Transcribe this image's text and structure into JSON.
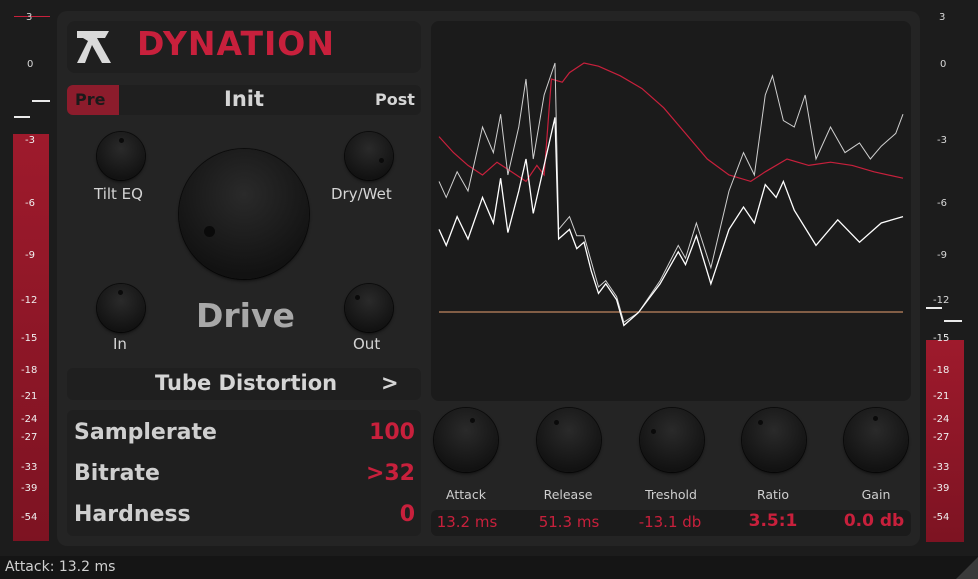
{
  "app": {
    "brand": "DYNATION",
    "accent": "#c8203c"
  },
  "meter_left": {
    "ticks": [
      "3",
      "0",
      "-3",
      "-6",
      "-9",
      "-12",
      "-15",
      "-18",
      "-21",
      "-24",
      "-27",
      "-33",
      "-39",
      "-54"
    ]
  },
  "meter_right": {
    "ticks": [
      "3",
      "0",
      "-3",
      "-6",
      "-9",
      "-12",
      "-15",
      "-18",
      "-21",
      "-24",
      "-27",
      "-33",
      "-39",
      "-54"
    ]
  },
  "routing": {
    "pre": "Pre",
    "preset": "Init",
    "post": "Post"
  },
  "knobs": {
    "tilt_eq": "Tilt EQ",
    "dry_wet": "Dry/Wet",
    "drive": "Drive",
    "in": "In",
    "out": "Out"
  },
  "mode": {
    "name": "Tube Distortion",
    "next": ">"
  },
  "params": [
    {
      "name": "Samplerate",
      "value": "100"
    },
    {
      "name": "Bitrate",
      "value": ">32"
    },
    {
      "name": "Hardness",
      "value": "0"
    }
  ],
  "comp": {
    "labels": [
      "Attack",
      "Release",
      "Treshold",
      "Ratio",
      "Gain"
    ],
    "values": [
      "13.2 ms",
      "51.3 ms",
      "-13.1 db",
      "3.5:1",
      "0.0 db"
    ]
  },
  "status": {
    "text": "Attack: 13.2 ms"
  },
  "scope": {
    "colors": {
      "red": "#c8203c",
      "white": "#ffffff",
      "grey": "#cfcfcf",
      "threshold": "#e8a070"
    },
    "series": {
      "white": [
        [
          0,
          0.62
        ],
        [
          0.02,
          0.67
        ],
        [
          0.05,
          0.58
        ],
        [
          0.08,
          0.65
        ],
        [
          0.12,
          0.52
        ],
        [
          0.15,
          0.6
        ],
        [
          0.17,
          0.46
        ],
        [
          0.19,
          0.63
        ],
        [
          0.22,
          0.5
        ],
        [
          0.24,
          0.4
        ],
        [
          0.26,
          0.57
        ],
        [
          0.29,
          0.42
        ],
        [
          0.32,
          0.27
        ],
        [
          0.33,
          0.65
        ],
        [
          0.36,
          0.62
        ],
        [
          0.38,
          0.68
        ],
        [
          0.4,
          0.66
        ],
        [
          0.42,
          0.75
        ],
        [
          0.44,
          0.82
        ],
        [
          0.46,
          0.79
        ],
        [
          0.49,
          0.84
        ],
        [
          0.51,
          0.92
        ],
        [
          0.55,
          0.88
        ],
        [
          0.61,
          0.79
        ],
        [
          0.66,
          0.69
        ],
        [
          0.68,
          0.73
        ],
        [
          0.71,
          0.64
        ],
        [
          0.75,
          0.79
        ],
        [
          0.8,
          0.62
        ],
        [
          0.84,
          0.55
        ],
        [
          0.87,
          0.6
        ],
        [
          0.9,
          0.48
        ],
        [
          0.93,
          0.52
        ],
        [
          0.95,
          0.47
        ],
        [
          0.98,
          0.56
        ],
        [
          1.04,
          0.67
        ],
        [
          1.1,
          0.59
        ],
        [
          1.16,
          0.66
        ],
        [
          1.22,
          0.6
        ],
        [
          1.28,
          0.58
        ]
      ],
      "grey": [
        [
          0,
          0.47
        ],
        [
          0.02,
          0.52
        ],
        [
          0.05,
          0.44
        ],
        [
          0.08,
          0.5
        ],
        [
          0.12,
          0.3
        ],
        [
          0.15,
          0.38
        ],
        [
          0.17,
          0.26
        ],
        [
          0.19,
          0.45
        ],
        [
          0.22,
          0.3
        ],
        [
          0.24,
          0.15
        ],
        [
          0.26,
          0.4
        ],
        [
          0.29,
          0.2
        ],
        [
          0.32,
          0.1
        ],
        [
          0.33,
          0.62
        ],
        [
          0.36,
          0.58
        ],
        [
          0.38,
          0.64
        ],
        [
          0.4,
          0.64
        ],
        [
          0.42,
          0.72
        ],
        [
          0.44,
          0.8
        ],
        [
          0.46,
          0.78
        ],
        [
          0.49,
          0.83
        ],
        [
          0.51,
          0.91
        ],
        [
          0.55,
          0.88
        ],
        [
          0.61,
          0.78
        ],
        [
          0.66,
          0.67
        ],
        [
          0.68,
          0.71
        ],
        [
          0.71,
          0.6
        ],
        [
          0.75,
          0.74
        ],
        [
          0.8,
          0.5
        ],
        [
          0.84,
          0.38
        ],
        [
          0.87,
          0.45
        ],
        [
          0.9,
          0.2
        ],
        [
          0.92,
          0.14
        ],
        [
          0.95,
          0.28
        ],
        [
          0.98,
          0.3
        ],
        [
          1.01,
          0.2
        ],
        [
          1.04,
          0.4
        ],
        [
          1.08,
          0.3
        ],
        [
          1.12,
          0.38
        ],
        [
          1.16,
          0.35
        ],
        [
          1.19,
          0.4
        ],
        [
          1.22,
          0.36
        ],
        [
          1.26,
          0.32
        ],
        [
          1.28,
          0.26
        ]
      ]
    }
  }
}
